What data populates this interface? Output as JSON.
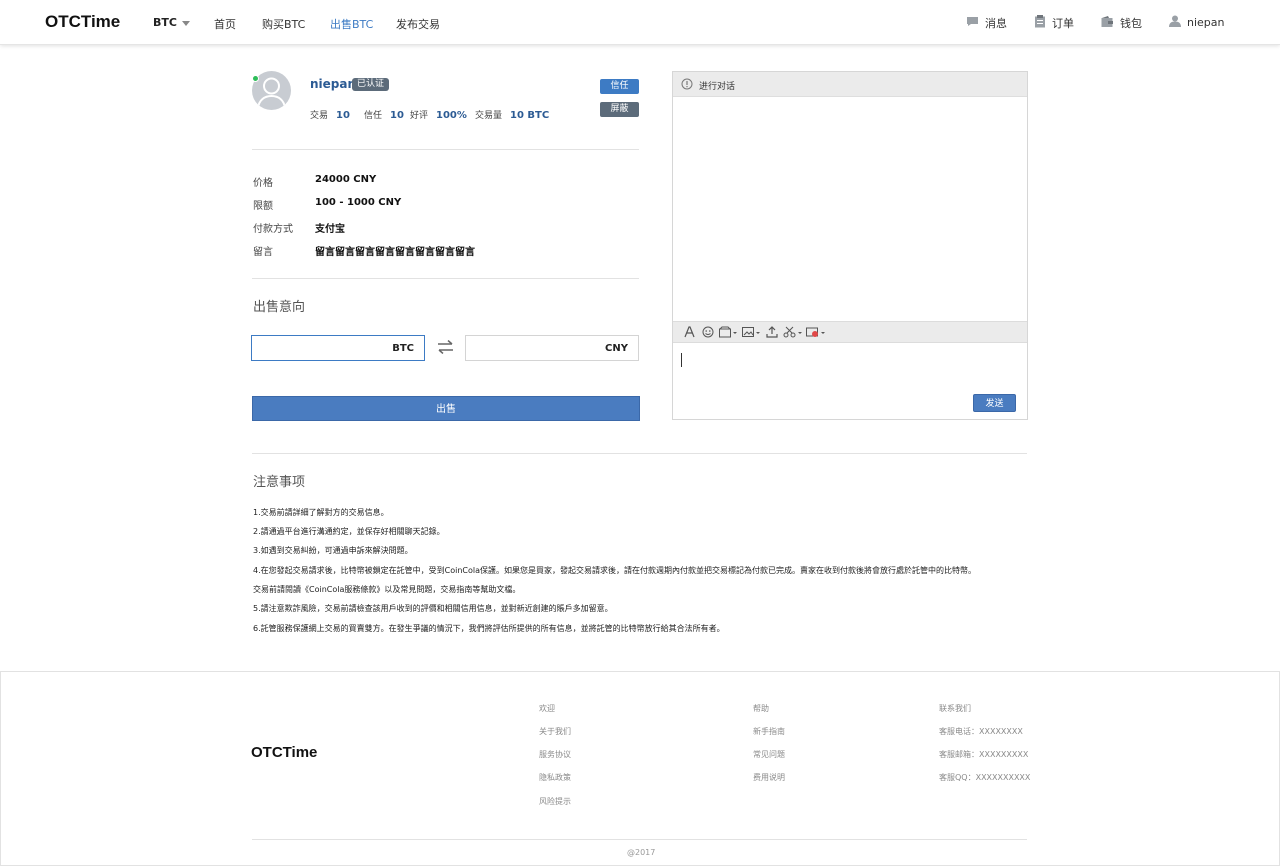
{
  "header": {
    "logo": "OTCTime",
    "coin": "BTC",
    "nav": [
      "首页",
      "购买BTC",
      "出售BTC",
      "发布交易"
    ],
    "active_nav": "出售BTC",
    "messages": "消息",
    "orders": "订单",
    "wallet": "钱包",
    "user": "niepan"
  },
  "seller": {
    "name": "niepan",
    "verified": "已认证",
    "stats": [
      {
        "label": "交易",
        "value": "10"
      },
      {
        "label": "信任",
        "value": "10"
      },
      {
        "label": "好评",
        "value": "100%"
      },
      {
        "label": "交易量",
        "value": "10 BTC"
      }
    ],
    "trust_button": "信任",
    "block_button": "屏蔽"
  },
  "details": [
    {
      "label": "价格",
      "value": "24000 CNY"
    },
    {
      "label": "限额",
      "value": "100 - 1000 CNY"
    },
    {
      "label": "付款方式",
      "value": "支付宝"
    },
    {
      "label": "留言",
      "value": "留言留言留言留言留言留言留言留言"
    }
  ],
  "sell": {
    "title": "出售意向",
    "btc_unit": "BTC",
    "cny_unit": "CNY",
    "btc_value": "",
    "cny_value": "",
    "button": "出售"
  },
  "chat": {
    "title": "进行对话",
    "send": "发送"
  },
  "notes": {
    "title": "注意事项",
    "items": [
      "1.交易前請詳細了解對方的交易信息。",
      "2.請通過平台進行溝通約定，並保存好相關聊天記錄。",
      "3.如遇到交易糾紛，可通過申訴來解決問題。",
      "4.在您發起交易請求後，比特幣被鎖定在託管中，受到CoinCola保護。如果您是買家，發起交易請求後，請在付款週期內付款並把交易標記為付款已完成。賣家在收到付款後將會放行處於託管中的比特幣。",
      "交易前請閱讀《CoinCola服務條款》以及常見問題，交易指南等幫助文檔。",
      "5.請注意欺詐風險，交易前請檢查該用戶收到的評價和相關信用信息，並對新近創建的賬戶多加留意。",
      "6.託管服務保護網上交易的買賣雙方。在發生爭議的情況下，我們將評估所提供的所有信息，並將託管的比特幣放行給其合法所有者。"
    ]
  },
  "footer": {
    "logo": "OTCTime",
    "col1": {
      "title": "欢迎",
      "links": [
        "关于我们",
        "服务协议",
        "隐私政策",
        "风险提示"
      ]
    },
    "col2": {
      "title": "帮助",
      "links": [
        "新手指南",
        "常见问题",
        "费用说明"
      ]
    },
    "col3": {
      "title": "联系我们",
      "links": [
        "客服电话：XXXXXXXX",
        "客服邮箱：XXXXXXXXX",
        "客服QQ：XXXXXXXXXX"
      ]
    },
    "copyright": "@2017"
  },
  "colors": {
    "accent": "#3d7bc4",
    "name": "#2c5b94",
    "badge": "#5c6b7a",
    "online": "#2ebd59"
  }
}
